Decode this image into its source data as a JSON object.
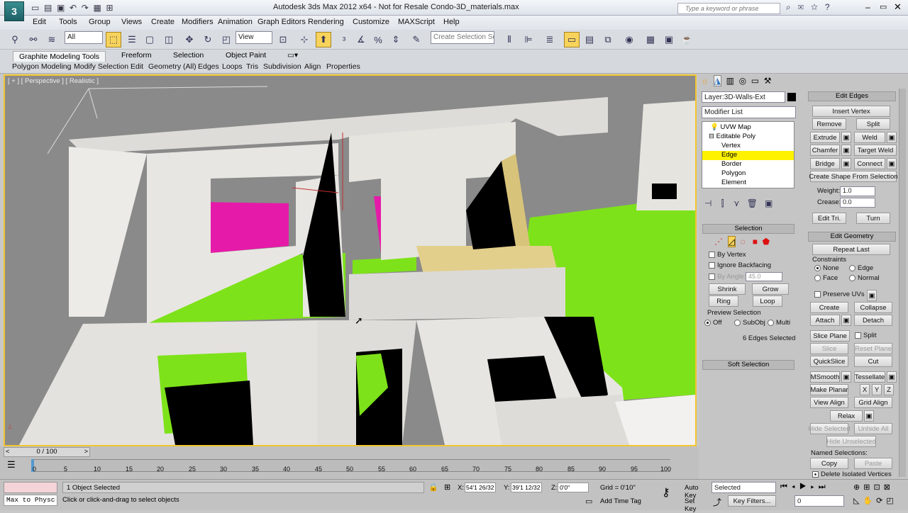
{
  "title": "Autodesk 3ds Max  2012 x64    - Not for Resale     Condo-3D_materials.max",
  "search_placeholder": "Type a keyword or phrase",
  "menu": [
    "Edit",
    "Tools",
    "Group",
    "Views",
    "Create",
    "Modifiers",
    "Animation",
    "Graph Editors",
    "Rendering",
    "Customize",
    "MAXScript",
    "Help"
  ],
  "toolbar": {
    "filter": "All",
    "refcoord": "View",
    "named_sel": "Create Selection Se"
  },
  "ribbon": {
    "tabs": [
      "Graphite Modeling Tools",
      "Freeform",
      "Selection",
      "Object Paint"
    ],
    "subtabs": [
      "Polygon Modeling",
      "Modify Selection",
      "Edit",
      "Geometry (All)",
      "Edges",
      "Loops",
      "Tris",
      "Subdivision",
      "Align",
      "Properties"
    ]
  },
  "viewport": {
    "label": "[ + ] [ Perspective ] [ Realistic ]"
  },
  "cmd": {
    "layer": "Layer:3D-Walls-Ext",
    "modifier_list": "Modifier List",
    "stack": [
      "UVW Map",
      "Editable Poly",
      "Vertex",
      "Edge",
      "Border",
      "Polygon",
      "Element"
    ],
    "selection": {
      "header": "Selection",
      "by_vertex": "By Vertex",
      "ignore_backfacing": "Ignore Backfacing",
      "by_angle": "By Angle:",
      "angle_value": "45.0",
      "shrink": "Shrink",
      "grow": "Grow",
      "ring": "Ring",
      "loop": "Loop",
      "preview": "Preview Selection",
      "off": "Off",
      "subobj": "SubObj",
      "multi": "Multi",
      "status": "6 Edges Selected"
    },
    "soft_selection": "Soft Selection",
    "edit_edges": {
      "header": "Edit Edges",
      "insert_vertex": "Insert Vertex",
      "remove": "Remove",
      "split": "Split",
      "extrude": "Extrude",
      "weld": "Weld",
      "chamfer": "Chamfer",
      "target_weld": "Target Weld",
      "bridge": "Bridge",
      "connect": "Connect",
      "create_shape": "Create Shape From Selection",
      "weight": "Weight:",
      "weight_value": "1.0",
      "crease": "Crease:",
      "crease_value": "0.0",
      "edit_tri": "Edit Tri.",
      "turn": "Turn"
    },
    "edit_geometry": {
      "header": "Edit Geometry",
      "repeat_last": "Repeat Last",
      "constraints": "Constraints",
      "none": "None",
      "edge": "Edge",
      "face": "Face",
      "normal": "Normal",
      "preserve_uvs": "Preserve UVs",
      "create": "Create",
      "collapse": "Collapse",
      "attach": "Attach",
      "detach": "Detach",
      "slice_plane": "Slice Plane",
      "split": "Split",
      "slice": "Slice",
      "reset_plane": "Reset Plane",
      "quickslice": "QuickSlice",
      "cut": "Cut",
      "msmooth": "MSmooth",
      "tessellate": "Tessellate",
      "make_planar": "Make Planar",
      "x": "X",
      "y": "Y",
      "z": "Z",
      "view_align": "View Align",
      "grid_align": "Grid Align",
      "relax": "Relax",
      "hide_selected": "Hide Selected",
      "unhide_all": "Unhide All",
      "hide_unselected": "Hide Unselected",
      "named_selections": "Named Selections:",
      "copy": "Copy",
      "paste": "Paste",
      "delete_isolated": "Delete Isolated Vertices"
    }
  },
  "timeline": {
    "frame": "0 / 100",
    "ticks": [
      "0",
      "5",
      "10",
      "15",
      "20",
      "25",
      "30",
      "35",
      "40",
      "45",
      "50",
      "55",
      "60",
      "65",
      "70",
      "75",
      "80",
      "85",
      "90",
      "95",
      "100"
    ]
  },
  "status": {
    "script": "Max to Physc",
    "objects": "1 Object Selected",
    "prompt": "Click or click-and-drag to select objects",
    "x_label": "X:",
    "x": "54'1 26/32",
    "y_label": "Y:",
    "y": "39'1 12/32",
    "z_label": "Z:",
    "z": "0'0\"",
    "grid": "Grid = 0'10\"",
    "add_time_tag": "Add Time Tag",
    "auto_key": "Auto Key",
    "set_key": "Set Key",
    "selected": "Selected",
    "key_filters": "Key Filters...",
    "frame_field": "0"
  }
}
